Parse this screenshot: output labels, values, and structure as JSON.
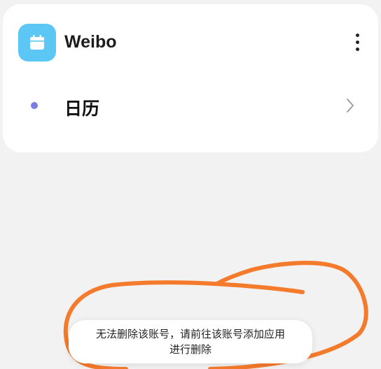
{
  "card": {
    "app_name": "Weibo",
    "app_icon": "calendar-icon",
    "more_icon": "more-vertical-icon",
    "account": {
      "label": "日历",
      "dot_color": "#7b7de0",
      "chevron_icon": "chevron-right-icon"
    }
  },
  "toast": {
    "line1": "无法删除该账号，请前往该账号添加应用",
    "line2": "进行删除"
  },
  "colors": {
    "background": "#f2f2f2",
    "card": "#ffffff",
    "app_icon_bg": "#5cc6f4",
    "annotation": "#f47a2c"
  }
}
